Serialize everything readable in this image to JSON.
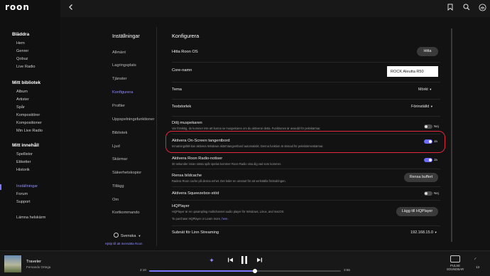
{
  "app": {
    "logo": "roon"
  },
  "sidebar": {
    "sections": [
      {
        "title": "Bläddra",
        "items": [
          "Hem",
          "Genrer",
          "Qobuz",
          "Live Radio"
        ]
      },
      {
        "title": "Mitt bibliotek",
        "items": [
          "Album",
          "Artister",
          "Spår",
          "Kompositörer",
          "Kompositioner",
          "Min Live Radio"
        ]
      },
      {
        "title": "Mitt innehåll",
        "items": [
          "Spellistor",
          "Etiketter",
          "Historik"
        ]
      }
    ],
    "bottom": [
      "Inställningar",
      "Forum",
      "Support",
      "Lämna helskärm"
    ]
  },
  "settings": {
    "title": "Inställningar",
    "items": [
      "Allmänt",
      "Lagringsplats",
      "Tjänster",
      "Konfigurera",
      "Profiler",
      "Uppspelningsfunktioner",
      "Bibliotek",
      "Ljud",
      "Skärmar",
      "Säkerhetskopior",
      "Tillägg",
      "Om",
      "Kortkommando"
    ],
    "language": "Svenska",
    "help_link": "Hjälp till att översätta Roon"
  },
  "config": {
    "title": "Konfigurera",
    "find_os": {
      "label": "Hitta Roon OS",
      "button": "Hitta"
    },
    "core_name": {
      "label": "Core-namn",
      "value": "ROCK Aleutta R50"
    },
    "theme": {
      "label": "Tema",
      "value": "Mörkt"
    },
    "text_size": {
      "label": "Textstorlek",
      "value": "Förinställd"
    },
    "hide_mouse": {
      "label": "Dölj muspekaren",
      "desc": "Var försiktig, du kommer inte att kunna se muspekaren om du aktiverar detta. Funktionen är avsedd för pekskärmar.",
      "state": "Nej"
    },
    "onscreen_kb": {
      "label": "Aktivera On-Screen tangentbord",
      "desc": "Inmatningsfält kan aktivera Windows skärmtangentbord automatiskt. Denna funktion är ämnad för pekskärmsskärmar.",
      "state": "Ja"
    },
    "radio_notes": {
      "label": "Aktivera Roon Radio-notiser",
      "desc": "30 sekunder innan nästa spår spelas kommer Roon Radio visa dig vad som kommer.",
      "state": "Ja"
    },
    "clear_cache": {
      "label": "Rensa bildcache",
      "desc": "Radera Roon cache på denna enhet. Det leder en omstart för att verkställa förändringen.",
      "button": "Rensa buffert"
    },
    "squeezebox": {
      "label": "Aktivera Squeezebox-stöd",
      "state": "Nej"
    },
    "hqplayer": {
      "label": "HQPlayer",
      "desc": "HQPlayer är en upsampling multichannel audio player för Windows, Linux, and macOS",
      "desc2": "To purchase HQPlayer or Learn more,",
      "link": "here.",
      "button": "Lägg till HQPlayer"
    },
    "linn": {
      "label": "Subnät för Linn Streaming",
      "value": "192.168.15.0"
    }
  },
  "player": {
    "track": "Traveler",
    "artist": "Fernando Ortega",
    "time_current": "2:10",
    "time_total": "3:55",
    "progress": 0.55,
    "zone": "PULSE SOUNDBAR",
    "volume": "13"
  },
  "colors": {
    "accent": "#7a76ff",
    "highlight": "#e0263b",
    "background": "#121212"
  },
  "icons": [
    "back-arrow-icon",
    "bookmark-icon",
    "search-icon",
    "signal-icon",
    "radio-icon",
    "previous-icon",
    "pause-icon",
    "next-icon",
    "zone-icon",
    "volume-icon",
    "chevron-down-icon",
    "globe-icon"
  ]
}
